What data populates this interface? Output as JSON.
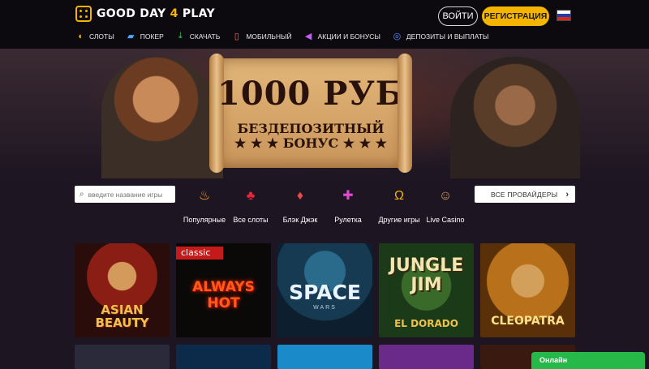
{
  "header": {
    "brand": {
      "prefix": "GOOD DAY",
      "accent": "4",
      "suffix": "PLAY"
    },
    "login_label": "ВОЙТИ",
    "register_label": "РЕГИСТРАЦИЯ",
    "language_flag": "russia-flag-icon",
    "nav": [
      {
        "label": "СЛОТЫ",
        "icon": "lemon-icon"
      },
      {
        "label": "ПОКЕР",
        "icon": "cards-icon"
      },
      {
        "label": "СКАЧАТЬ",
        "icon": "download-icon"
      },
      {
        "label": "МОБИЛЬНЫЙ",
        "icon": "mobile-icon"
      },
      {
        "label": "АКЦИИ И БОНУСЫ",
        "icon": "megaphone-icon"
      },
      {
        "label": "ДЕПОЗИТЫ И ВЫПЛАТЫ",
        "icon": "coins-icon"
      }
    ]
  },
  "banner": {
    "headline": "1000 РУБ",
    "subline_1": "БЕЗДЕПОЗИТНЫЙ",
    "subline_2": "★ ★ ★ БОНУС ★ ★ ★"
  },
  "filters": {
    "search_placeholder": "введите название игры",
    "categories": [
      {
        "label": "Популярные",
        "icon": "flame-icon"
      },
      {
        "label": "Все слоты",
        "icon": "cherries-icon"
      },
      {
        "label": "Блэк Джэк",
        "icon": "playing-cards-icon"
      },
      {
        "label": "Рулетка",
        "icon": "roulette-icon"
      },
      {
        "label": "Другие игры",
        "icon": "horseshoe-icon"
      },
      {
        "label": "Live Casino",
        "icon": "dealer-icon"
      }
    ],
    "providers_label": "ВСЕ ПРОВАЙДЕРЫ"
  },
  "games": [
    {
      "title": "ASIAN BEAUTY"
    },
    {
      "title": "ALWAYS HOT",
      "badge": "classic"
    },
    {
      "title": "SPACE",
      "subtitle": "WARS"
    },
    {
      "title": "JUNGLE JIM",
      "subtitle": "EL DORADO"
    },
    {
      "title": "CLEOPATRA"
    }
  ],
  "chat": {
    "status_label": "Онлайн"
  },
  "colors": {
    "accent": "#f5b400",
    "online": "#27b84a",
    "badge": "#c41a1a"
  }
}
